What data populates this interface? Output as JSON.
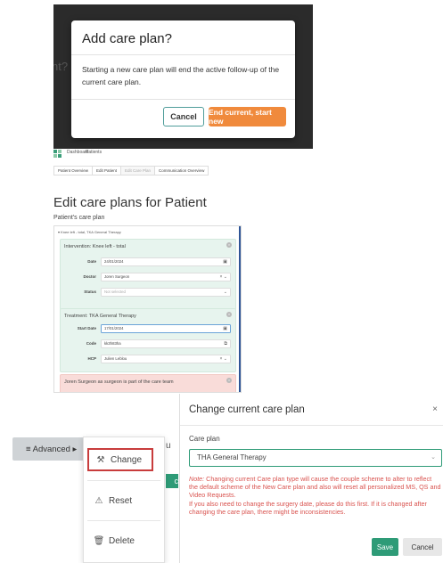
{
  "add_modal": {
    "bg_text": "nt?",
    "title": "Add care plan?",
    "body": "Starting a new care plan will end the active follow-up of the current care plan.",
    "cancel_label": "Cancel",
    "confirm_label": "End current, start new"
  },
  "nav": {
    "crumbs": [
      "Dashboard",
      "Patients"
    ],
    "tabs": [
      {
        "label": "Patient Overview"
      },
      {
        "label": "Edit Patient"
      },
      {
        "label": "Edit Care Plan"
      },
      {
        "label": "Communication Overview"
      }
    ]
  },
  "page": {
    "title": "Edit care plans for Patient",
    "subtitle": "Patient's care plan",
    "plan_header": "Knee left - total, TKA General Therapy"
  },
  "intervention": {
    "title": "Intervention: Knee left - total",
    "date_label": "Date",
    "date_value": "24/01/2024",
    "doctor_label": "Doctor",
    "doctor_value": "Joren Surgeon",
    "status_label": "Status",
    "status_placeholder": "Not selected"
  },
  "treatment": {
    "title": "Treatment: TKA General Therapy",
    "start_label": "Start Date",
    "start_value": "17/01/2024",
    "code_label": "Code",
    "code_value": "kk3h83ha",
    "hcp_label": "HCP",
    "hcp_value": "Julien Leblou"
  },
  "care_team_note": "Joren Surgeon as surgeon is part of the care team",
  "context_menu": {
    "advanced_label": "≡ Advanced ▸",
    "bg_tail": "u",
    "chip_text": "c",
    "items": [
      {
        "label": "Change",
        "icon": "wrench-icon"
      },
      {
        "label": "Reset",
        "icon": "warning-icon"
      },
      {
        "label": "Delete",
        "icon": "trash-icon"
      }
    ]
  },
  "change_dialog": {
    "title": "Change current care plan",
    "close": "×",
    "label": "Care plan",
    "selected": "THA General Therapy",
    "note_prefix": "Note:",
    "note_body": " Changing current Care plan type will cause the couple scheme to alter to reflect the default scheme of the New Care plan and also will reset all personalized MS, QS and Video Requests.",
    "note_body2": "If you also need to change the surgery date, please do this first. If it is changed after changing the care plan, there might be inconsistencies.",
    "save_label": "Save",
    "cancel_label": "Cancel"
  },
  "colors": {
    "accent": "#2e9b77",
    "orange": "#f08a3c",
    "error": "#d9534f",
    "highlight_border": "#c83c3c"
  }
}
